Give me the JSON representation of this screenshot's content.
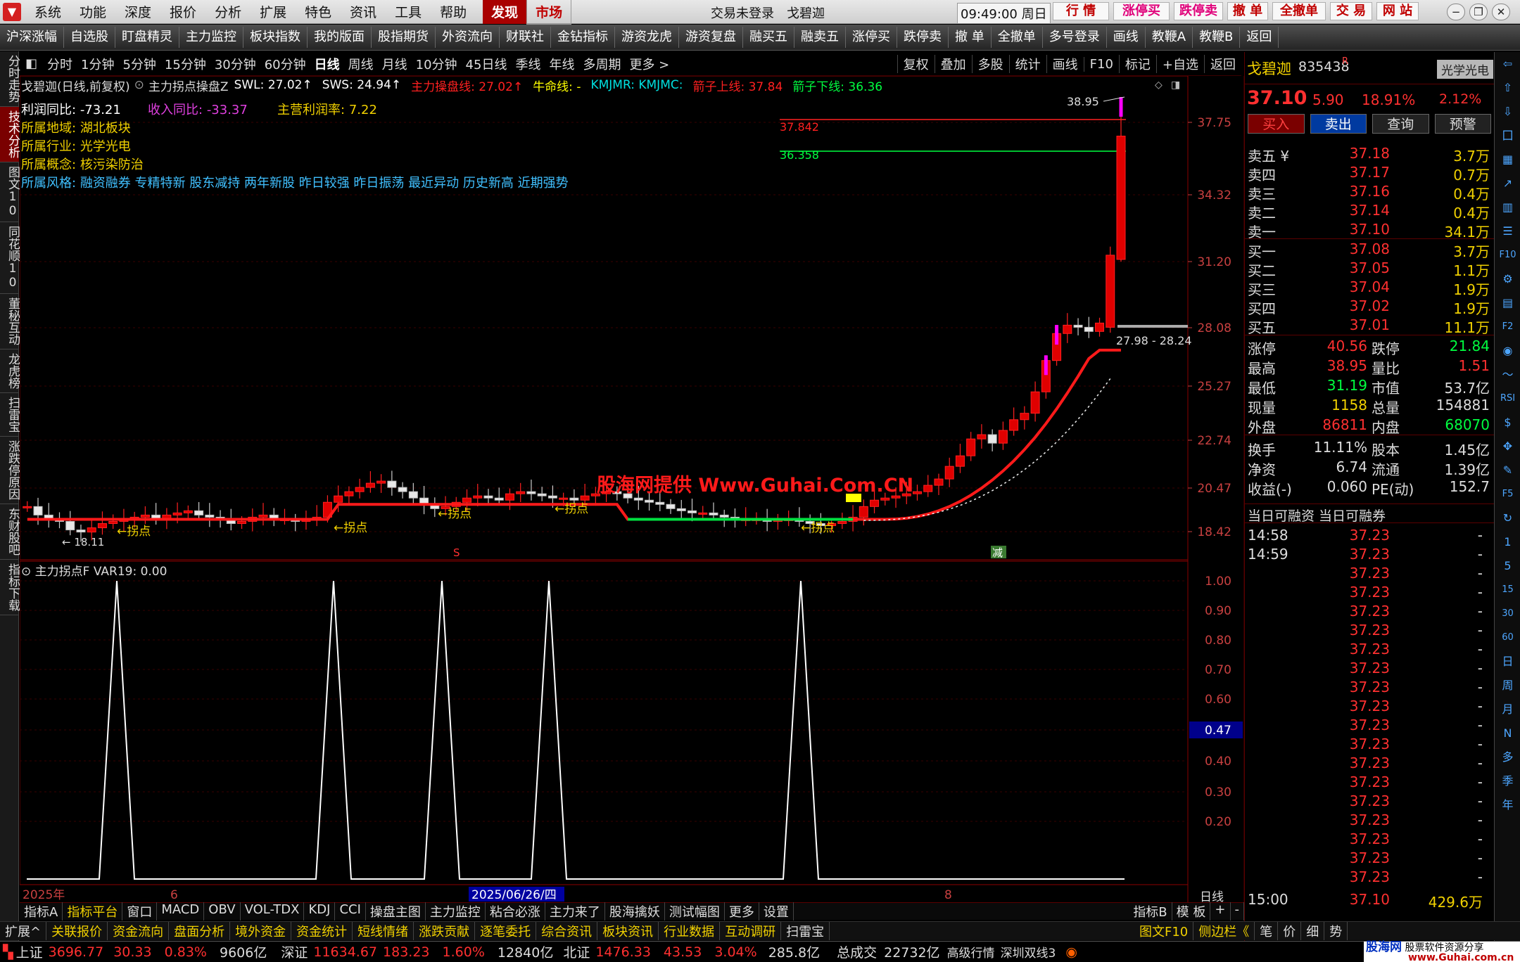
{
  "menu": {
    "items": [
      "系统",
      "功能",
      "深度",
      "报价",
      "分析",
      "扩展",
      "特色",
      "资讯",
      "工具",
      "帮助"
    ],
    "discover": "发现",
    "market": "市场",
    "trade_status": "交易未登录",
    "stock": "戈碧迦",
    "time": "09:49:00 周日",
    "right_buttons": [
      "行 情",
      "涨停买",
      "跌停卖",
      "撤 单",
      "全撤单",
      "交 易",
      "网 站"
    ]
  },
  "toolbar": {
    "items": [
      "沪深涨幅",
      "自选股",
      "盯盘精灵",
      "主力监控",
      "板块指数",
      "我的版面",
      "股指期货",
      "外资流向",
      "财联社",
      "金钻指标",
      "游资龙虎",
      "游资复盘",
      "融买五",
      "融卖五",
      "涨停买",
      "跌停卖",
      "撤 单",
      "全撤单",
      "多号登录",
      "画线",
      "教鞭A",
      "教鞭B",
      "返回"
    ]
  },
  "leftbar": {
    "items": [
      "分时走势",
      "技术分析",
      "图文10",
      "同花顺10",
      "董秘互动",
      "龙虎榜",
      "扫雷宝",
      "涨跌停原因",
      "东财股吧",
      "指标下载"
    ],
    "active": 1
  },
  "period": {
    "items": [
      "分时",
      "1分钟",
      "5分钟",
      "15分钟",
      "30分钟",
      "60分钟",
      "日线",
      "周线",
      "月线",
      "10分钟",
      "45日线",
      "季线",
      "年线",
      "多周期",
      "更多 >"
    ],
    "active": 6,
    "tools": [
      "复权",
      "叠加",
      "多股",
      "统计",
      "画线",
      "F10",
      "标记",
      "+自选",
      "返回"
    ]
  },
  "chart": {
    "title": "戈碧迦(日线,前复权)",
    "indicator": "主力拐点操盘Z",
    "swl": "SWL: 27.02↑",
    "sws": "SWS: 24.94↑",
    "zlcp": "主力操盘线: 27.02↑",
    "niu": "牛命线: -",
    "kmj": "KMJMR: KMJMC:",
    "upper": "箭子上线: 37.84",
    "lower": "箭子下线: 36.36",
    "lines": {
      "profit_yoy_label": "利润同比:",
      "profit_yoy": "-73.21",
      "rev_yoy_label": "收入同比:",
      "rev_yoy": "-33.37",
      "margin_label": "主营利润率:",
      "margin": "7.22",
      "region_label": "所属地域:",
      "region": "湖北板块",
      "industry_label": "所属行业:",
      "industry": "光学光电",
      "concept_label": "所属概念:",
      "concept": "核污染防治",
      "style_label": "所属风格:",
      "style": "融资融券 专精特新 股东减持 两年新股 昨日较强 昨日振荡 最近异动 历史新高 近期强势"
    },
    "yticks": [
      "37.75",
      "34.32",
      "31.20",
      "28.08",
      "25.27",
      "22.74",
      "20.47",
      "18.42"
    ],
    "hline_upper": "37.842",
    "hline_lower": "36.358",
    "peak": "38.95",
    "low": "18.11",
    "range": "27.98 - 28.24",
    "turn_label": "←拐点",
    "watermark": "股海网提供 Www.Guhai.Com.CN",
    "marker_s": "S",
    "marker_jian": "减"
  },
  "sub": {
    "title": "主力拐点F",
    "var": "VAR19: 0.00",
    "yticks": [
      "1.00",
      "0.90",
      "0.80",
      "0.70",
      "0.60",
      "0.47",
      "0.40",
      "0.30",
      "0.20"
    ],
    "xlabels": [
      "2025年",
      "6",
      "2025/06/26/四",
      "8"
    ],
    "period": "日线"
  },
  "bottomtabs": {
    "items": [
      "指标A",
      "指标平台",
      "窗口",
      "MACD",
      "OBV",
      "VOL-TDX",
      "KDJ",
      "CCI",
      "操盘主图",
      "主力监控",
      "粘合必涨",
      "主力来了",
      "股海擒妖",
      "测试幅图",
      "更多",
      "设置"
    ],
    "right": [
      "指标B",
      "模 板",
      "+",
      "-"
    ]
  },
  "bottom2": {
    "items": [
      "扩展^",
      "关联报价",
      "资金流向",
      "盘面分析",
      "境外资金",
      "资金统计",
      "短线情绪",
      "涨跌贡献",
      "逐笔委托",
      "综合资讯",
      "板块资讯",
      "行业数据",
      "互动调研",
      "扫雷宝"
    ],
    "right": [
      "图文F10",
      "侧边栏《",
      "笔",
      "价",
      "细",
      "势"
    ]
  },
  "status": {
    "sh": "上证",
    "sh_v": "3696.77",
    "sh_c": "30.33",
    "sh_p": "0.83%",
    "sh_a": "9606亿",
    "sz": "深证",
    "sz_v": "11634.67",
    "sz_c": "183.23",
    "sz_p": "1.60%",
    "sz_a": "12840亿",
    "bz": "北证",
    "bz_v": "1476.33",
    "bz_c": "43.53",
    "bz_p": "3.04%",
    "bz_a": "285.8亿",
    "total": "总成交",
    "total_v": "22732亿",
    "hq": "高级行情",
    "line": "深圳双线3",
    "brand": "股海网",
    "brand2": "股票软件资源分享",
    "brand_url": "www.Guhai.com.cn"
  },
  "rp": {
    "name": "戈碧迦",
    "code": "835438",
    "r": "R",
    "sector": "光学光电",
    "price": "37.10",
    "chg": "5.90",
    "pct": "18.91%",
    "sector_pct": "2.12%",
    "buttons": [
      "买入",
      "卖出",
      "查询",
      "预警"
    ],
    "sell": [
      [
        "卖五 ¥",
        "37.18",
        "3.7万"
      ],
      [
        "卖四",
        "37.17",
        "0.7万"
      ],
      [
        "卖三",
        "37.16",
        "0.4万"
      ],
      [
        "卖二",
        "37.14",
        "0.4万"
      ],
      [
        "卖一",
        "37.10",
        "34.1万"
      ]
    ],
    "buy": [
      [
        "买一",
        "37.08",
        "3.7万"
      ],
      [
        "买二",
        "37.05",
        "1.1万"
      ],
      [
        "买三",
        "37.04",
        "1.9万"
      ],
      [
        "买四",
        "37.02",
        "1.9万"
      ],
      [
        "买五",
        "37.01",
        "11.1万"
      ]
    ],
    "stats": [
      [
        "涨停",
        "40.56",
        "跌停",
        "21.84"
      ],
      [
        "最高",
        "38.95",
        "量比",
        "1.51"
      ],
      [
        "最低",
        "31.19",
        "市值",
        "53.7亿"
      ],
      [
        "现量",
        "1158",
        "总量",
        "154881"
      ],
      [
        "外盘",
        "86811",
        "内盘",
        "68070"
      ],
      [
        "换手",
        "11.11%",
        "股本",
        "1.45亿"
      ],
      [
        "净资",
        "6.74",
        "流通",
        "1.39亿"
      ],
      [
        "收益(-)",
        "0.060",
        "PE(动)",
        "152.7"
      ]
    ],
    "margin": "当日可融资 当日可融券",
    "ticks": [
      [
        "14:58",
        "37.23",
        "-"
      ],
      [
        "14:59",
        "37.23",
        "-"
      ],
      [
        "",
        "37.23",
        "-"
      ],
      [
        "",
        "37.23",
        "-"
      ],
      [
        "",
        "37.23",
        "-"
      ],
      [
        "",
        "37.23",
        "-"
      ],
      [
        "",
        "37.23",
        "-"
      ],
      [
        "",
        "37.23",
        "-"
      ],
      [
        "",
        "37.23",
        "-"
      ],
      [
        "",
        "37.23",
        "-"
      ],
      [
        "",
        "37.23",
        "-"
      ],
      [
        "",
        "37.23",
        "-"
      ],
      [
        "",
        "37.23",
        "-"
      ],
      [
        "",
        "37.23",
        "-"
      ],
      [
        "",
        "37.23",
        "-"
      ],
      [
        "",
        "37.23",
        "-"
      ],
      [
        "",
        "37.23",
        "-"
      ],
      [
        "",
        "37.23",
        "-"
      ],
      [
        "",
        "37.23",
        "-"
      ],
      [
        "15:00",
        "37.10",
        "429.6万"
      ]
    ]
  },
  "iconbar": [
    "⇦",
    "⇧",
    "⇩",
    "囗",
    "▦",
    "↗",
    "▥",
    "☰",
    "F10",
    "⚙",
    "▤",
    "F2",
    "◉",
    "〜",
    "RSI",
    "$",
    "✥",
    "✎",
    "F5",
    "↻",
    "1",
    "5",
    "15",
    "30",
    "60",
    "日",
    "周",
    "月",
    "N",
    "多",
    "季",
    "年"
  ]
}
